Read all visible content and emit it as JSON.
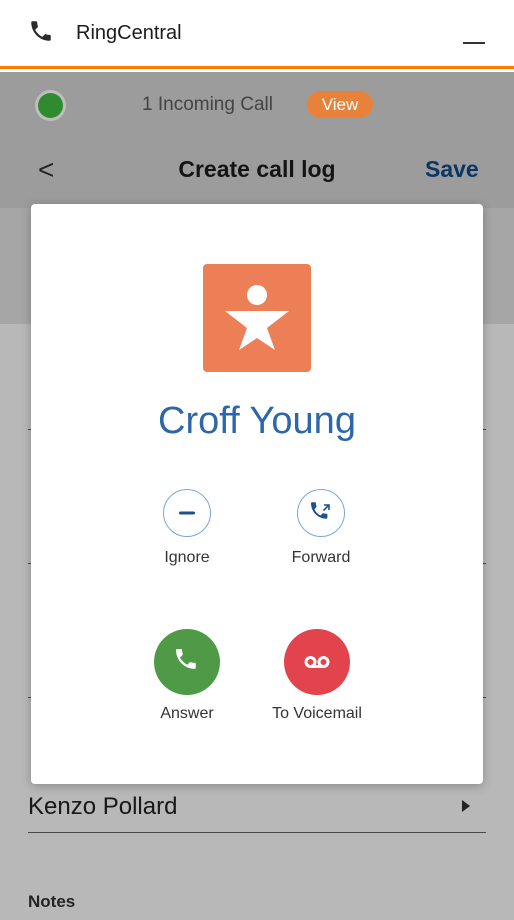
{
  "window": {
    "app_title": "RingCentral"
  },
  "banner": {
    "text": "1 Incoming Call",
    "view_label": "View",
    "status_color": "#2e8b2e"
  },
  "header": {
    "back_label": "<",
    "title": "Create call log",
    "save_label": "Save"
  },
  "form": {
    "contact_value": "Kenzo Pollard",
    "notes_label": "Notes"
  },
  "incoming_call": {
    "caller_name": "Croff Young",
    "actions": {
      "ignore": "Ignore",
      "forward": "Forward",
      "answer": "Answer",
      "voicemail": "To Voicemail"
    }
  },
  "colors": {
    "accent": "#ff7a00",
    "answer": "#4f9a46",
    "voicemail": "#e2434d",
    "avatar": "#ec7f55",
    "link": "#0f4b8a"
  }
}
